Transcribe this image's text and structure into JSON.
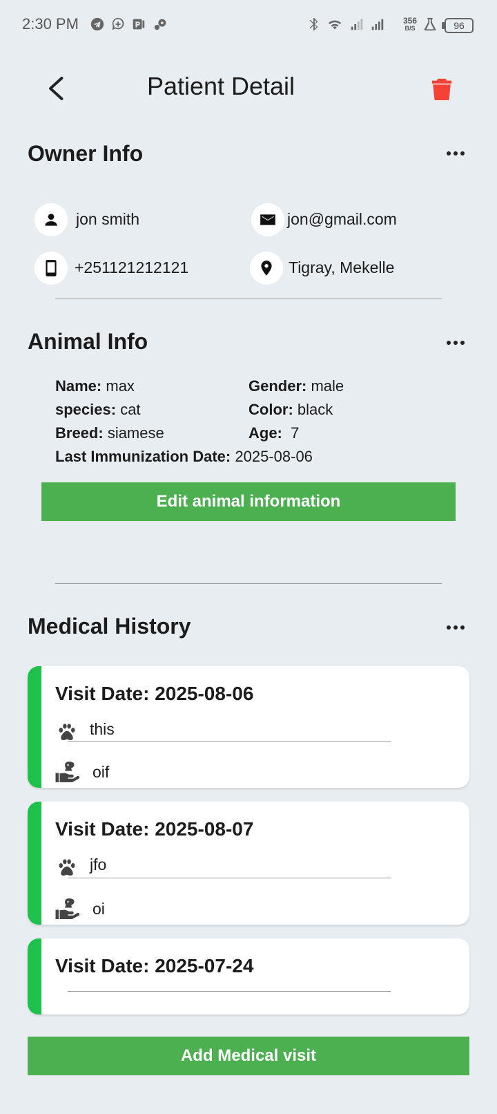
{
  "status_bar": {
    "time": "2:30 PM",
    "net_speed_value": "356",
    "net_speed_unit": "B/S",
    "battery": "96"
  },
  "app_bar": {
    "title": "Patient Detail"
  },
  "owner": {
    "section_title": "Owner Info",
    "name": "jon smith",
    "email": "jon@gmail.com",
    "phone": "+251121212121",
    "location": "Tigray, Mekelle"
  },
  "animal": {
    "section_title": "Animal Info",
    "name_label": "Name:",
    "name_value": "max",
    "gender_label": "Gender:",
    "gender_value": "male",
    "species_label": "species:",
    "species_value": "cat",
    "color_label": "Color:",
    "color_value": "black",
    "breed_label": "Breed:",
    "breed_value": "siamese",
    "age_label": "Age:",
    "age_value": "7",
    "immunization_label": "Last Immunization Date:",
    "immunization_value": "2025-08-06",
    "edit_button": "Edit animal information"
  },
  "medical_history": {
    "section_title": "Medical History",
    "visits": [
      {
        "date_label": "Visit Date: 2025-08-06",
        "symptom": "this",
        "treatment": "oif"
      },
      {
        "date_label": "Visit Date: 2025-08-07",
        "symptom": "jfo",
        "treatment": "oi"
      },
      {
        "date_label": "Visit Date: 2025-07-24",
        "symptom": "",
        "treatment": ""
      }
    ],
    "add_button": "Add Medical visit"
  },
  "colors": {
    "background": "#e8edf2",
    "accent_green": "#4caf50",
    "stripe_green": "#1ec24a",
    "delete_red": "#f44336"
  },
  "icons": {
    "owner": [
      "person-icon",
      "mail-icon",
      "phone-icon",
      "location-pin-icon"
    ],
    "visit": [
      "paw-icon",
      "pet-care-hand-icon"
    ]
  }
}
